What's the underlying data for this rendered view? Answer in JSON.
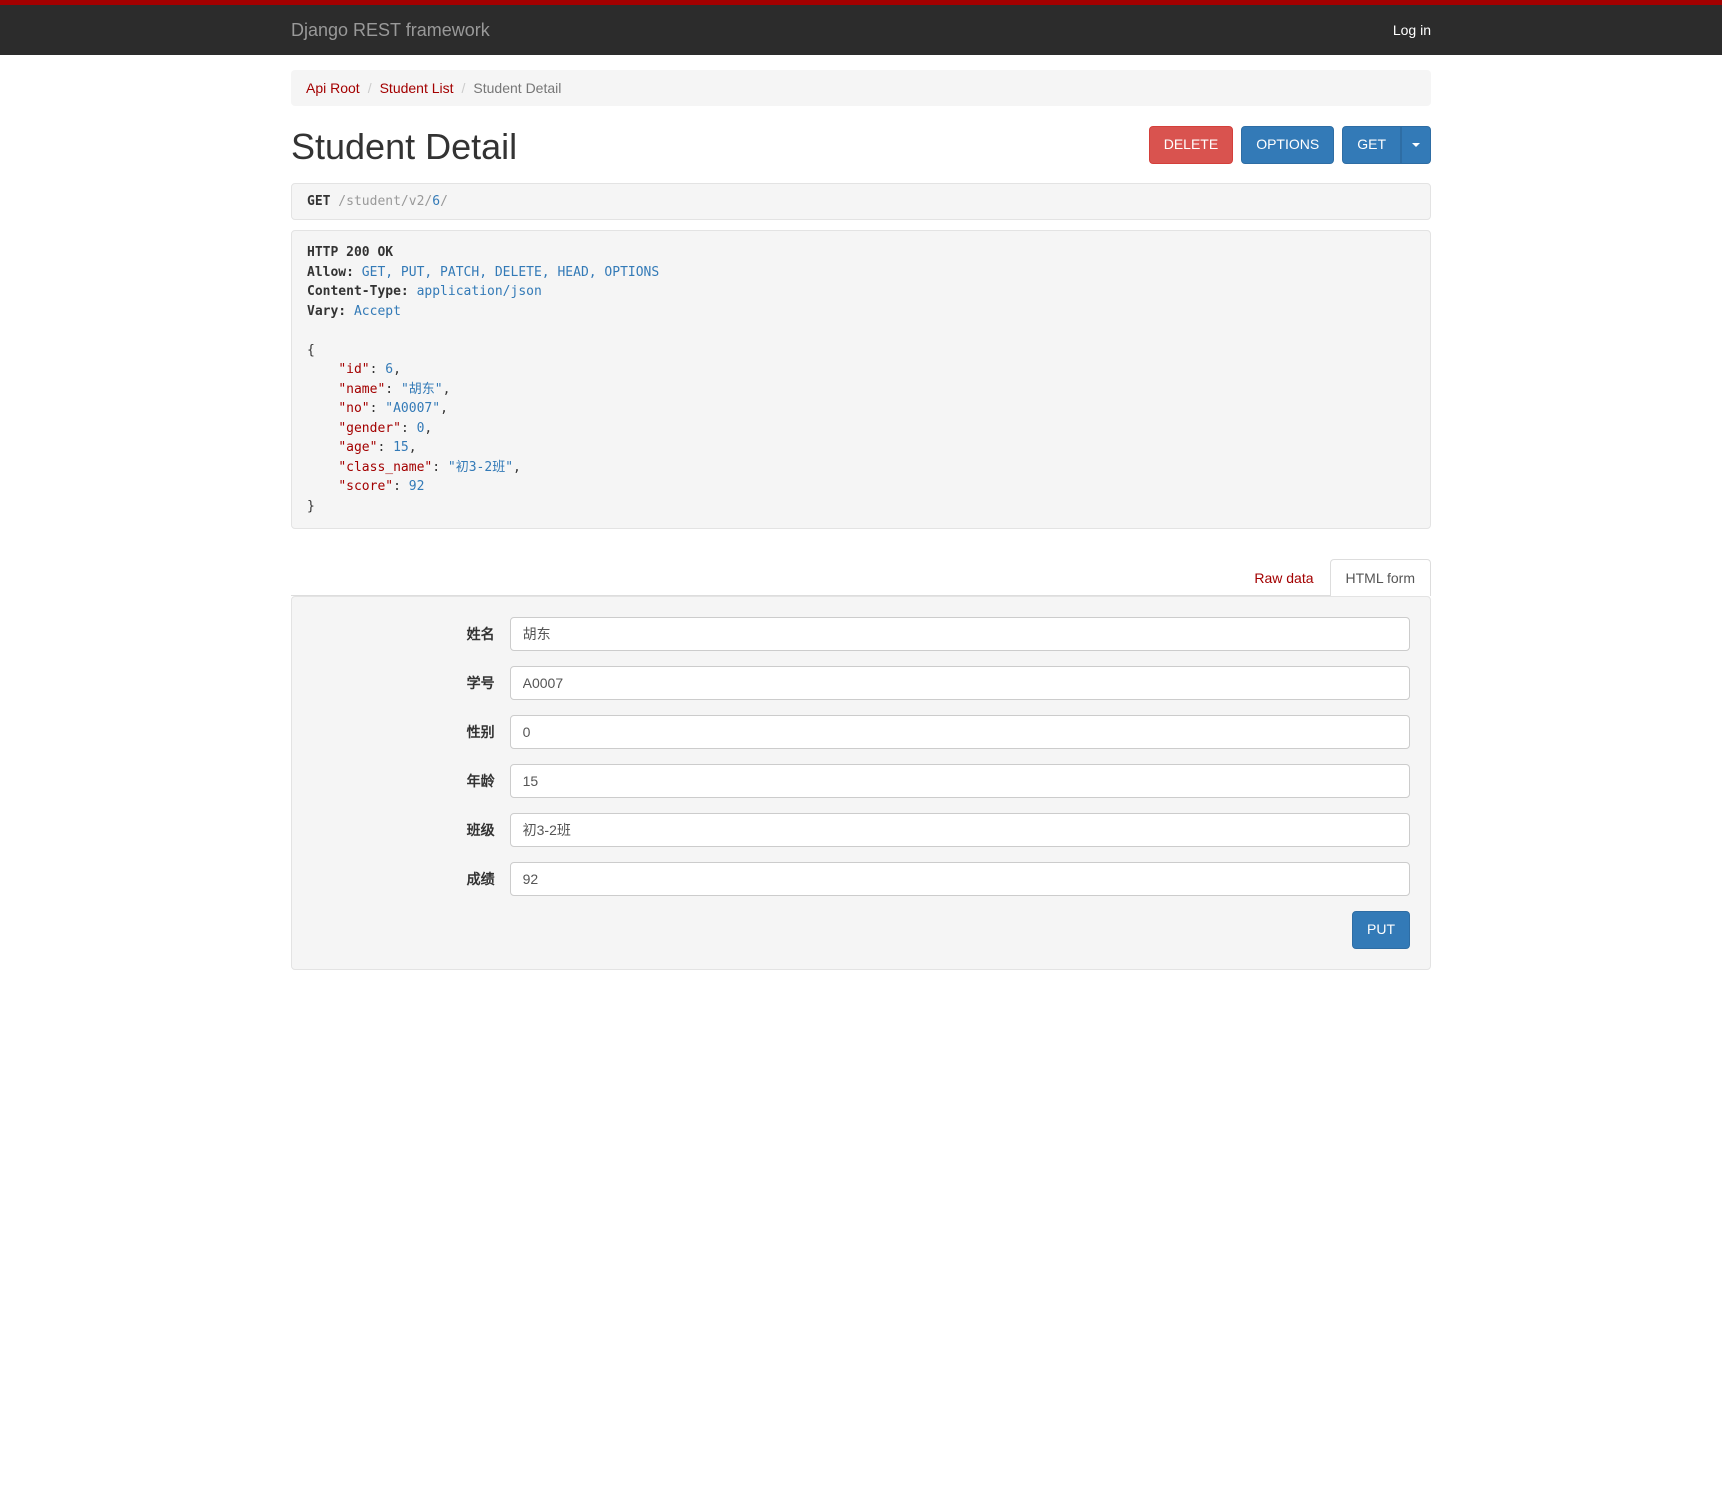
{
  "navbar": {
    "brand": "Django REST framework",
    "login": "Log in"
  },
  "breadcrumb": {
    "items": [
      {
        "label": "Api Root"
      },
      {
        "label": "Student List"
      }
    ],
    "active": "Student Detail"
  },
  "page": {
    "title": "Student Detail"
  },
  "buttons": {
    "delete": "DELETE",
    "options": "OPTIONS",
    "get": "GET"
  },
  "request": {
    "method": "GET",
    "path_prefix": " /student/v2/",
    "id": "6",
    "path_suffix": "/"
  },
  "response": {
    "status_line": "HTTP 200 OK",
    "headers": {
      "allow_key": "Allow:",
      "allow_val": " GET, PUT, PATCH, DELETE, HEAD, OPTIONS",
      "ctype_key": "Content-Type:",
      "ctype_val": " application/json",
      "vary_key": "Vary:",
      "vary_val": " Accept"
    },
    "body": {
      "id_key": "\"id\"",
      "id_val": "6",
      "name_key": "\"name\"",
      "name_val": "\"胡东\"",
      "no_key": "\"no\"",
      "no_val": "\"A0007\"",
      "gender_key": "\"gender\"",
      "gender_val": "0",
      "age_key": "\"age\"",
      "age_val": "15",
      "class_key": "\"class_name\"",
      "class_val": "\"初3-2班\"",
      "score_key": "\"score\"",
      "score_val": "92"
    }
  },
  "tabs": {
    "raw": "Raw data",
    "html": "HTML form"
  },
  "form": {
    "fields": {
      "name": {
        "label": "姓名",
        "value": "胡东"
      },
      "no": {
        "label": "学号",
        "value": "A0007"
      },
      "gender": {
        "label": "性别",
        "value": "0"
      },
      "age": {
        "label": "年龄",
        "value": "15"
      },
      "class_name": {
        "label": "班级",
        "value": "初3-2班"
      },
      "score": {
        "label": "成绩",
        "value": "92"
      }
    },
    "submit": "PUT"
  }
}
